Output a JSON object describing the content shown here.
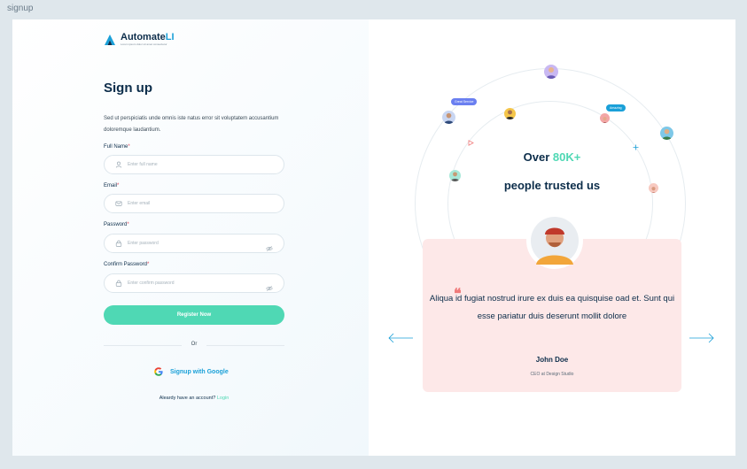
{
  "frame_label": "signup",
  "brand": {
    "name_part1": "Automate",
    "name_part2": "LI",
    "tagline": "Lorem ipsum dolor sit amet consectetur"
  },
  "form": {
    "title": "Sign up",
    "description": "Sed ut perspiciatis unde omnis iste natus error sit voluptatem accusantium doloremque laudantium.",
    "full_name": {
      "label": "Full Name",
      "required": "*",
      "placeholder": "Enter full name"
    },
    "email": {
      "label": "Email",
      "required": "*",
      "placeholder": "Enter email"
    },
    "password": {
      "label": "Password",
      "required": "*",
      "placeholder": "Enter password"
    },
    "confirm_password": {
      "label": "Confirm Password",
      "required": "*",
      "placeholder": "Enter confirm password"
    },
    "register_label": "Register Now",
    "or_label": "Or",
    "google_label": "Signup with Google",
    "login_prompt": "Aleardy have an account?",
    "login_link": "Login"
  },
  "promo": {
    "over": "Over",
    "count": "80K+",
    "subline": "people trusted us",
    "bubble_1": "Great Service",
    "bubble_2": "Amazing"
  },
  "testimonial": {
    "quote": "Aliqua id fugiat nostrud irure ex duis ea quisquise oad et. Sunt qui esse pariatur duis deserunt mollit dolore",
    "name": "John Doe",
    "role": "CEO at Design Studio"
  },
  "icons": {
    "logo": "automateli-logo-icon",
    "user": "user-icon",
    "mail": "mail-icon",
    "lock": "lock-icon",
    "eye": "eye-off-icon",
    "google": "google-icon",
    "prev": "arrow-left-icon",
    "next": "arrow-right-icon"
  },
  "colors": {
    "accent": "#4fd8b4",
    "brand_blue": "#1aa0d8",
    "card": "#fde8e8",
    "text": "#0c2d4a"
  }
}
